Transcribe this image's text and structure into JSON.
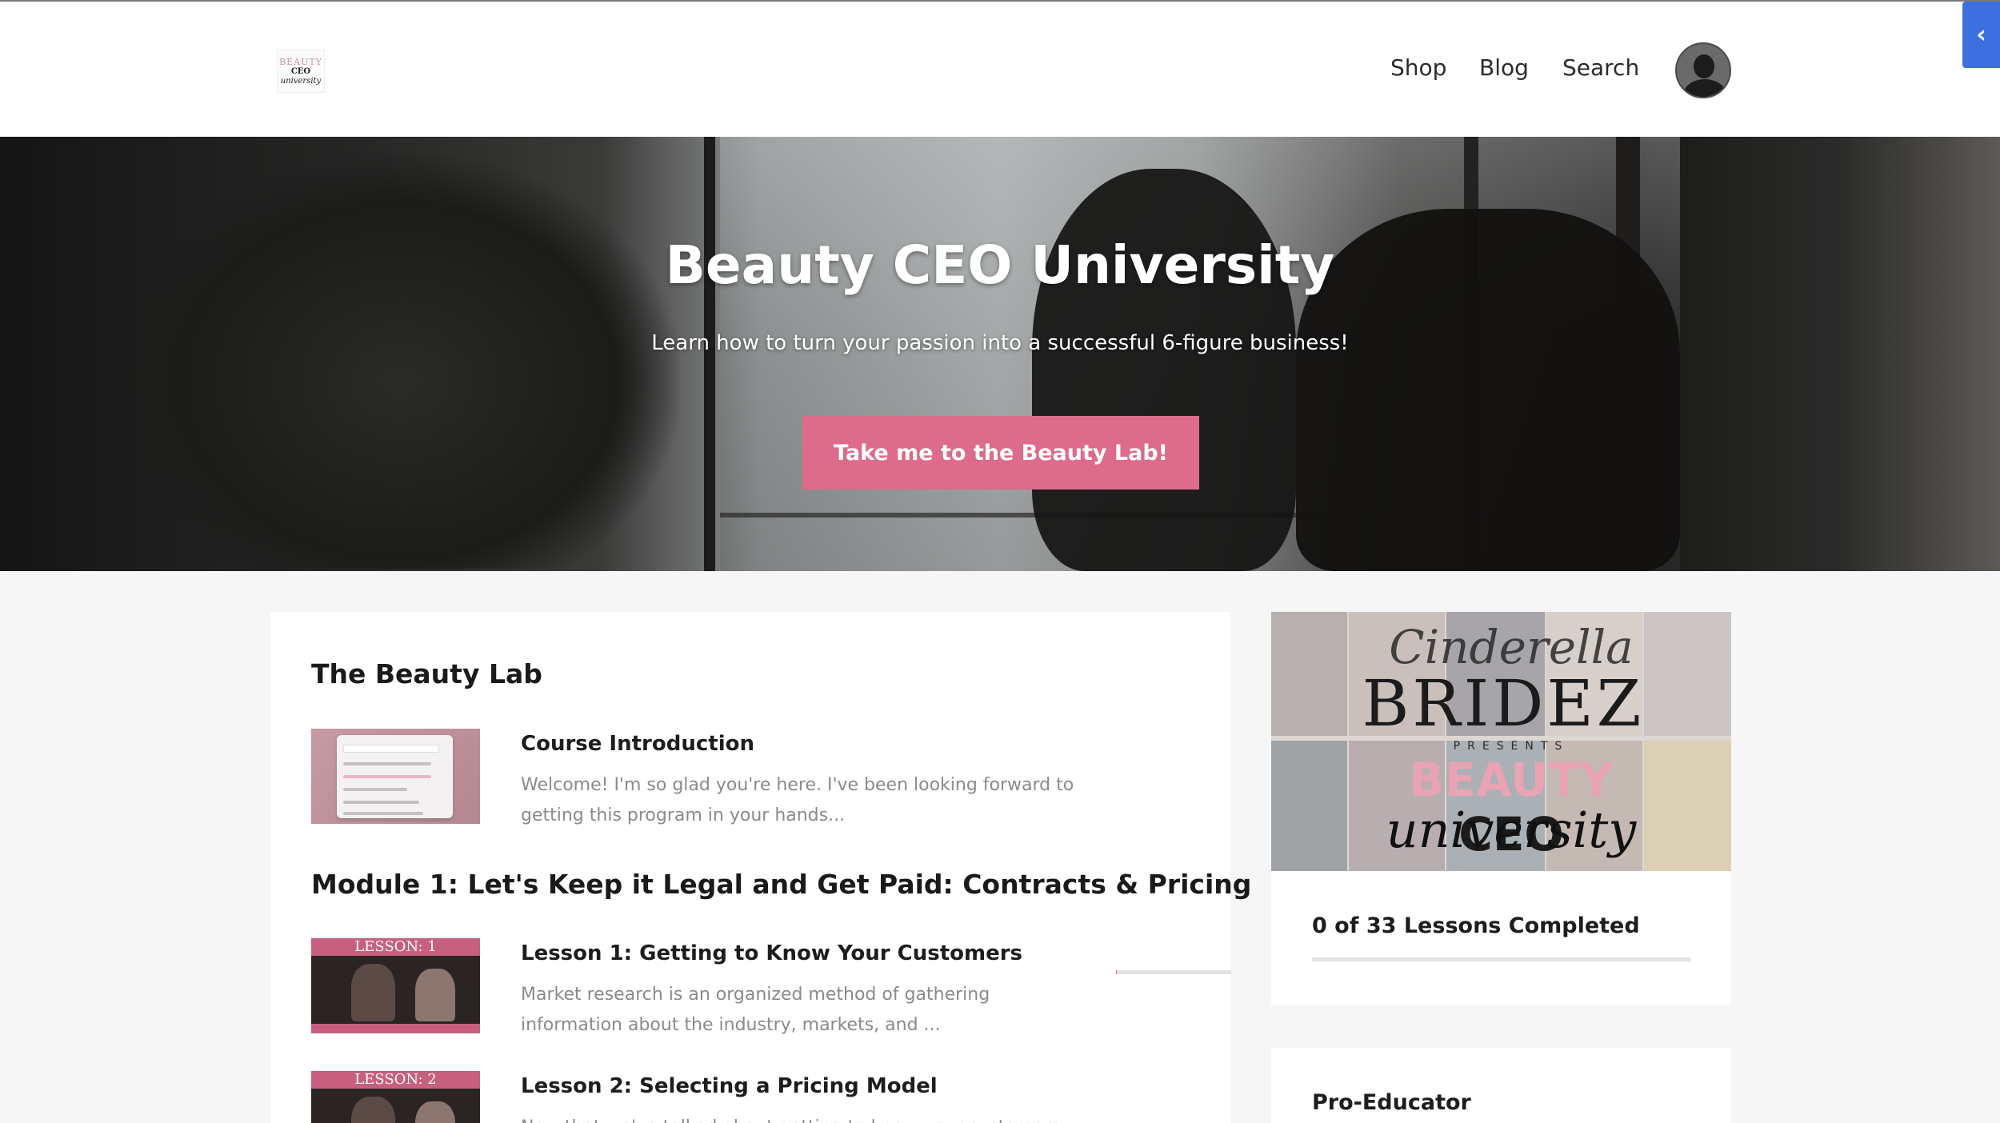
{
  "header": {
    "logo": {
      "line1": "BEAUTY",
      "line2": "CEO",
      "line3": "university"
    },
    "nav": [
      {
        "label": "Shop"
      },
      {
        "label": "Blog"
      },
      {
        "label": "Search"
      }
    ],
    "side_tab_icon": "chevron-left-icon"
  },
  "hero": {
    "title": "Beauty CEO University",
    "subtitle": "Learn how to turn your passion into a successful 6-figure business!",
    "button_label": "Take me to the Beauty Lab!"
  },
  "main": {
    "sections": [
      {
        "title": "The Beauty Lab"
      },
      {
        "title": "Module 1: Let's Keep it Legal and Get Paid: Contracts & Pricing"
      }
    ],
    "lessons": [
      {
        "title": "Course Introduction",
        "description": "Welcome! I'm so glad you're here. I've been looking forward to getting this program in your hands...",
        "thumb": "intro"
      },
      {
        "title": "Lesson 1: Getting to Know Your Customers",
        "description": "Market research is an organized method of gathering information about the industry, markets, and ...",
        "thumb_label": "LESSON: 1",
        "progress": 0.01
      },
      {
        "title": "Lesson 2: Selecting a Pricing Model",
        "description": "Now that we've talked about getting to know your customers...",
        "thumb_label": "LESSON: 2"
      }
    ]
  },
  "sidebar": {
    "promo": {
      "script_top": "Cinderella",
      "bridez": "BRIDEZ",
      "presents": "PRESENTS",
      "beauty": "BEAUTY",
      "ceo": "CEO",
      "university": "university"
    },
    "progress": {
      "label": "0 of 33 Lessons Completed",
      "completed": 0,
      "total": 33
    },
    "educator_label": "Pro-Educator"
  },
  "colors": {
    "accent": "#dd6b8a",
    "side_tab": "#3d6fe0",
    "background": "#f6f6f6"
  }
}
